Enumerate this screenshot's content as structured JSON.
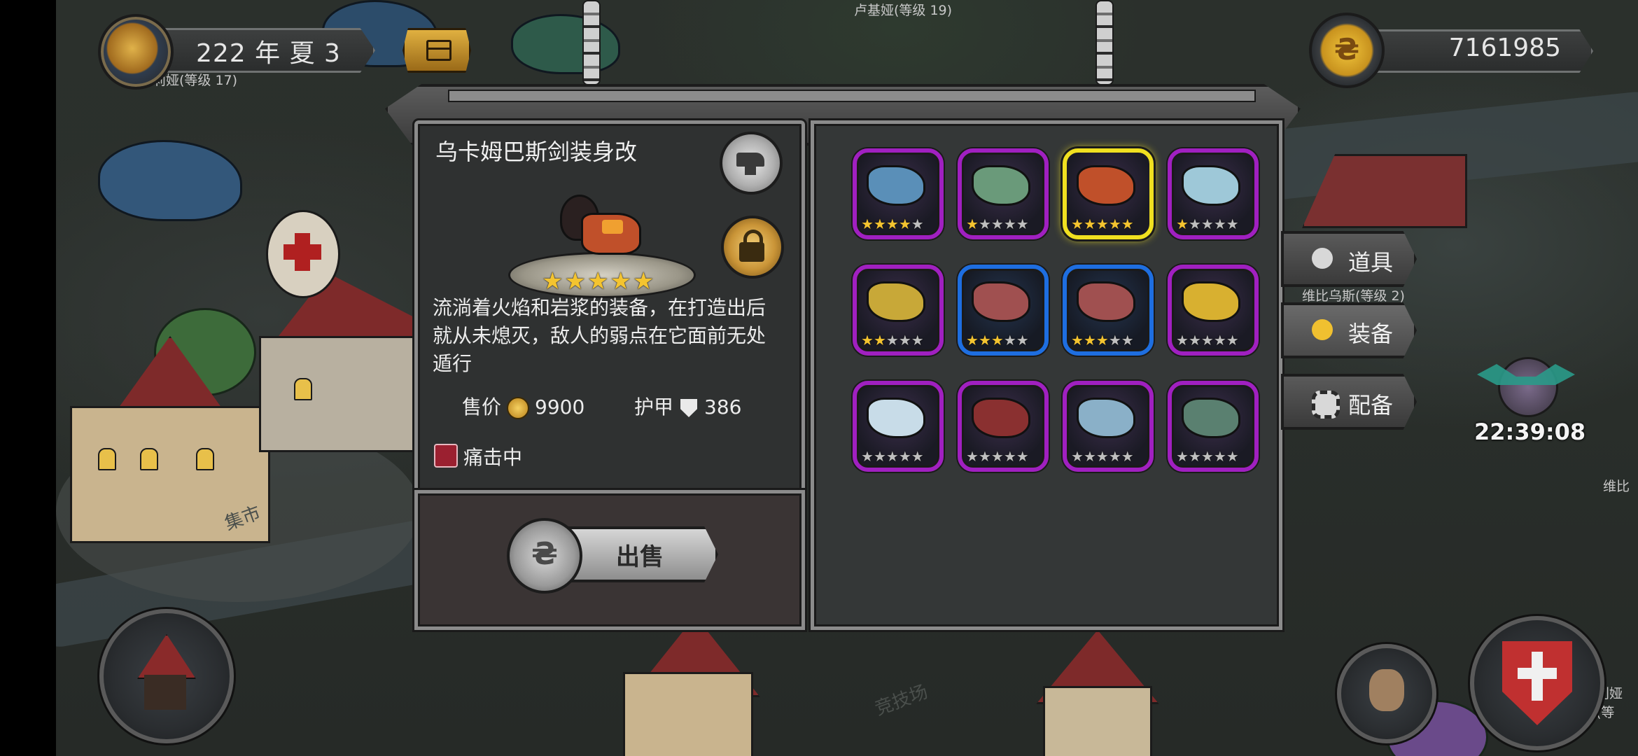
{
  "hud": {
    "date": "222 年 夏 3",
    "coins": "7161985",
    "coin_symbol": "₴"
  },
  "world_labels": {
    "npc_top": "卢基娅(等级 19)",
    "npc_left": "莉娅(等级 17)",
    "npc_right": "维比乌斯(等级 2)",
    "npc_right_edge": "维比",
    "npc_bottom_right": "利娅(等",
    "arena": "竞技场",
    "market": "集市"
  },
  "item": {
    "name": "乌卡姆巴斯剑装身改",
    "stars": 5,
    "description": "流淌着火焰和岩浆的装备，在打造出后就从未熄灭，敌人的弱点在它面前无处遁行",
    "price_label": "售价",
    "price": "9900",
    "armor_label": "护甲",
    "armor": "386",
    "skill": "痛击中",
    "sell_label": "出售",
    "sell_coin_symbol": "₴"
  },
  "grid": [
    {
      "rarity": "epic",
      "stars": 4,
      "selected": false,
      "color": "#5a8fb8"
    },
    {
      "rarity": "epic",
      "stars": 1,
      "selected": false,
      "color": "#6a9a7a"
    },
    {
      "rarity": "epic",
      "stars": 5,
      "selected": true,
      "color": "#c0502a"
    },
    {
      "rarity": "epic",
      "stars": 1,
      "selected": false,
      "color": "#9ec8d8"
    },
    {
      "rarity": "epic",
      "stars": 2,
      "selected": false,
      "color": "#c8a838"
    },
    {
      "rarity": "rare",
      "stars": 3,
      "selected": false,
      "color": "#a05050"
    },
    {
      "rarity": "rare",
      "stars": 3,
      "selected": false,
      "color": "#a05050"
    },
    {
      "rarity": "epic",
      "stars": 0,
      "selected": false,
      "color": "#d8b030"
    },
    {
      "rarity": "epic",
      "stars": 0,
      "selected": false,
      "color": "#c8dce8"
    },
    {
      "rarity": "epic",
      "stars": 0,
      "selected": false,
      "color": "#8a3030"
    },
    {
      "rarity": "epic",
      "stars": 0,
      "selected": false,
      "color": "#8ab0c8"
    },
    {
      "rarity": "epic",
      "stars": 0,
      "selected": false,
      "color": "#5a8070"
    }
  ],
  "tabs": [
    {
      "label": "道具",
      "icon": "bag-icon",
      "active": false
    },
    {
      "label": "装备",
      "icon": "helmet-icon",
      "active": true
    },
    {
      "label": "配备",
      "icon": "gear-icon",
      "active": false
    }
  ],
  "clock": "22:39:08",
  "colors": {
    "epic_border": "#a020c0",
    "rare_border": "#1e6ee0",
    "selected_border": "#f0e020",
    "star_on": "#f4c430",
    "star_off": "#bfbfbf"
  }
}
